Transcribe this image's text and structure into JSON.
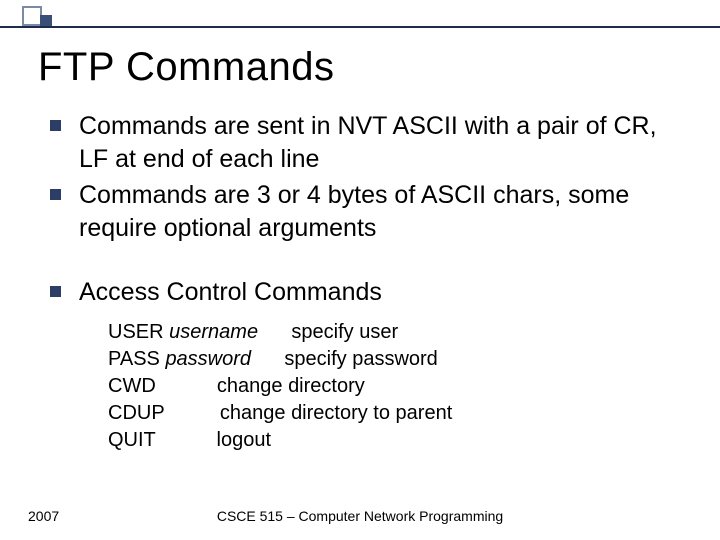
{
  "title": "FTP Commands",
  "bullets": {
    "b0": "Commands are sent in NVT ASCII with a pair of CR, LF at end of each line",
    "b1": "Commands are 3 or 4 bytes of ASCII chars, some require optional arguments",
    "b2": "Access Control Commands"
  },
  "commands": {
    "c0": {
      "cmd": "USER",
      "arg": "username",
      "desc": "specify user"
    },
    "c1": {
      "cmd": "PASS",
      "arg": "password",
      "desc": "specify password"
    },
    "c2": {
      "cmd": "CWD",
      "arg": "",
      "desc": "change directory"
    },
    "c3": {
      "cmd": "CDUP",
      "arg": "",
      "desc": "change directory to parent"
    },
    "c4": {
      "cmd": "QUIT",
      "arg": "",
      "desc": "logout"
    }
  },
  "footer": {
    "year": "2007",
    "course": "CSCE 515 – Computer Network Programming"
  }
}
